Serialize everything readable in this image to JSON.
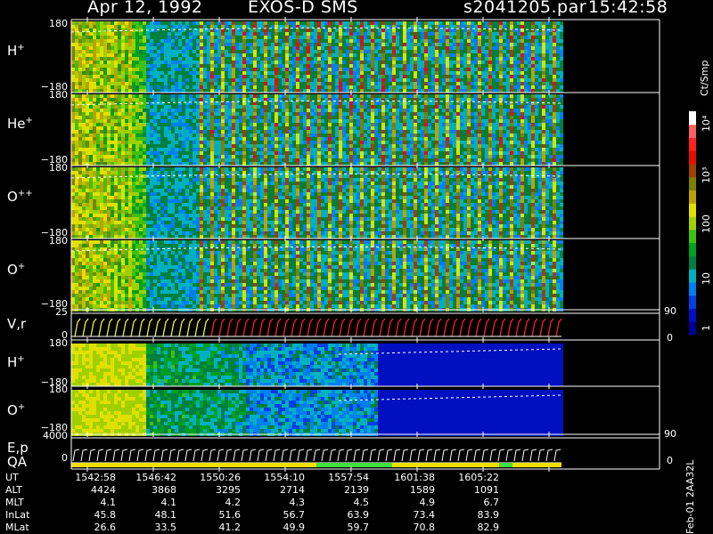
{
  "header": {
    "date": "Apr 12, 1992",
    "instrument": "EXOS-D SMS",
    "file": "s2041205.par",
    "time": "15:42:58"
  },
  "panels": [
    {
      "label": "H",
      "sup": "+",
      "top_tick": "180",
      "bottom_tick": "−180"
    },
    {
      "label": "He",
      "sup": "+",
      "top_tick": "180",
      "bottom_tick": "−180"
    },
    {
      "label": "O",
      "sup": "++",
      "top_tick": "180",
      "bottom_tick": "−180"
    },
    {
      "label": "O",
      "sup": "+",
      "top_tick": "180",
      "bottom_tick": "−180"
    }
  ],
  "vr_panel": {
    "label": "V,r",
    "top_tick": "25",
    "bottom_tick": "0",
    "right_top": "90",
    "right_bottom": "0"
  },
  "h_panel2": {
    "label": "H",
    "sup": "+",
    "top_tick": "180",
    "bottom_tick": "−180"
  },
  "o_panel2": {
    "label": "O",
    "sup": "+",
    "top_tick": "180",
    "bottom_tick": "−180"
  },
  "ep_panel": {
    "label": "E,p",
    "label2": "QA",
    "top_tick": "4000",
    "bottom_tick": "0",
    "right_top": "90",
    "right_bottom": "0"
  },
  "colorbar": {
    "unit": "Ct/Smp",
    "ticks": [
      {
        "label": "1"
      },
      {
        "label": "10"
      },
      {
        "label": "100"
      },
      {
        "label": "10³"
      },
      {
        "label": "10⁴"
      }
    ],
    "colors": [
      "#000090",
      "#0010c0",
      "#0040e0",
      "#0080f0",
      "#00b0c0",
      "#008040",
      "#00a020",
      "#40c010",
      "#a0d000",
      "#e0e000",
      "#c0a000",
      "#808000",
      "#a04000",
      "#e01000",
      "#ff2020",
      "#ff6060",
      "#ffffff"
    ]
  },
  "footer_stamp": "Feb-01 2AA32L",
  "table": {
    "rows": [
      {
        "label": "UT",
        "values": [
          "1542:58",
          "1546:42",
          "1550:26",
          "1554:10",
          "1557:54",
          "1601:38",
          "1605:22"
        ]
      },
      {
        "label": "ALT",
        "values": [
          "4424",
          "3868",
          "3295",
          "2714",
          "2139",
          "1589",
          "1091"
        ]
      },
      {
        "label": "MLT",
        "values": [
          "4.1",
          "4.1",
          "4.2",
          "4.3",
          "4.5",
          "4.9",
          "6.7"
        ]
      },
      {
        "label": "InLat",
        "values": [
          "45.8",
          "48.1",
          "51.6",
          "56.7",
          "63.9",
          "73.4",
          "83.9"
        ]
      },
      {
        "label": "MLat",
        "values": [
          "26.6",
          "33.5",
          "41.2",
          "49.9",
          "59.7",
          "70.8",
          "82.9"
        ]
      }
    ]
  },
  "chart_data": {
    "type": "heatmap",
    "title": "Apr 12, 1992   EXOS-D SMS",
    "time_labels": [
      "1542:58",
      "1546:42",
      "1550:26",
      "1554:10",
      "1557:54",
      "1601:38",
      "1605:22"
    ],
    "panels": [
      "H+",
      "He+",
      "O++",
      "O+",
      "V,r",
      "H+",
      "O+",
      "E,p"
    ],
    "pitch_angle_range": [
      -180,
      180
    ],
    "vr_range": [
      0,
      25
    ],
    "energy_range": [
      0,
      4000
    ],
    "colorbar_unit": "Ct/Smp",
    "colorbar_range": [
      1,
      10000
    ],
    "colorbar_scale": "log"
  }
}
